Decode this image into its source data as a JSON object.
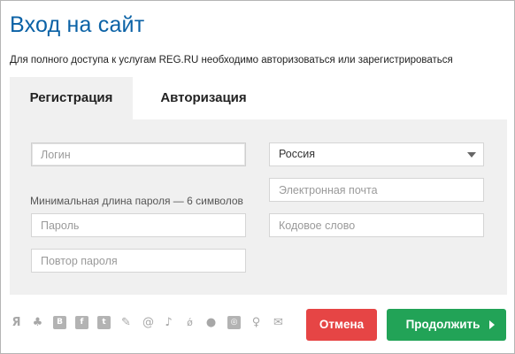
{
  "dialog": {
    "title": "Вход на сайт",
    "subtitle": "Для полного доступа к услугам REG.RU необходимо авторизоваться или зарегистрироваться"
  },
  "tabs": [
    {
      "label": "Регистрация",
      "active": true
    },
    {
      "label": "Авторизация",
      "active": false
    }
  ],
  "form": {
    "login_placeholder": "Логин",
    "password_hint": "Минимальная длина пароля — 6 символов",
    "password_placeholder": "Пароль",
    "repeat_password_placeholder": "Повтор пароля",
    "country_value": "Россия",
    "email_placeholder": "Электронная почта",
    "codeword_placeholder": "Кодовое слово"
  },
  "social_icons": [
    "yandex-icon",
    "person-icon",
    "vk-icon",
    "facebook-icon",
    "twitter-icon",
    "pen-icon",
    "mail-at-icon",
    "tiktok-icon",
    "openid-icon",
    "github-icon",
    "instagram-icon",
    "odnoklassniki-icon",
    "email-check-icon"
  ],
  "buttons": {
    "cancel_label": "Отмена",
    "continue_label": "Продолжить"
  },
  "colors": {
    "title": "#0b62a6",
    "cancel": "#e64545",
    "continue": "#22a357",
    "panel": "#f0f0f0"
  }
}
